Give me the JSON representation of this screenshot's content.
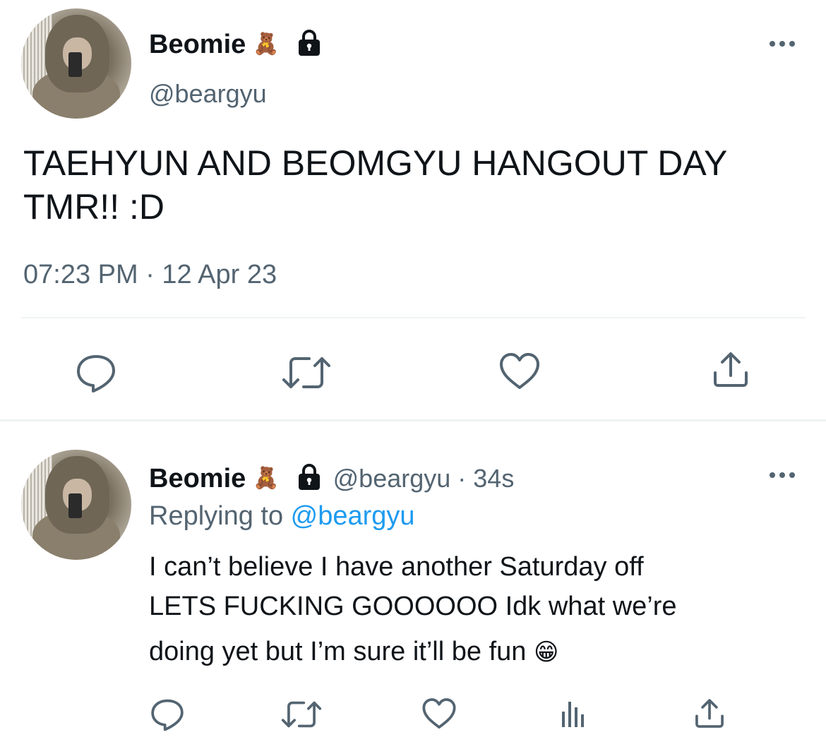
{
  "main_tweet": {
    "display_name": "Beomie",
    "name_emoji": "🧸",
    "lock_icon": "lock-icon",
    "handle": "@beargyu",
    "text_line1": "TAEHYUN AND BEOMGYU HANGOUT DAY",
    "text_line2": "TMR!! :D",
    "timestamp": "07:23 PM · 12 Apr 23",
    "more_icon": "more-icon",
    "actions": [
      "reply-icon",
      "retweet-icon",
      "like-icon",
      "share-icon"
    ]
  },
  "reply_tweet": {
    "display_name": "Beomie",
    "name_emoji": "🧸",
    "lock_icon": "lock-icon",
    "handle_time": "@beargyu · 34s",
    "replying_prefix": "Replying to ",
    "replying_handle": "@beargyu",
    "text_line1": "I can’t believe I have another Saturday off",
    "text_line2": "LETS FUCKING GOOOOOO Idk what we’re",
    "text_line3": "doing yet but I’m sure it’ll be fun",
    "text_emoji": "😁",
    "more_icon": "more-icon",
    "actions": [
      "reply-icon",
      "retweet-icon",
      "like-icon",
      "analytics-icon",
      "share-icon"
    ]
  },
  "colors": {
    "text": "#0f1419",
    "secondary": "#536471",
    "link": "#1d9bf0",
    "divider": "#eff3f4"
  }
}
